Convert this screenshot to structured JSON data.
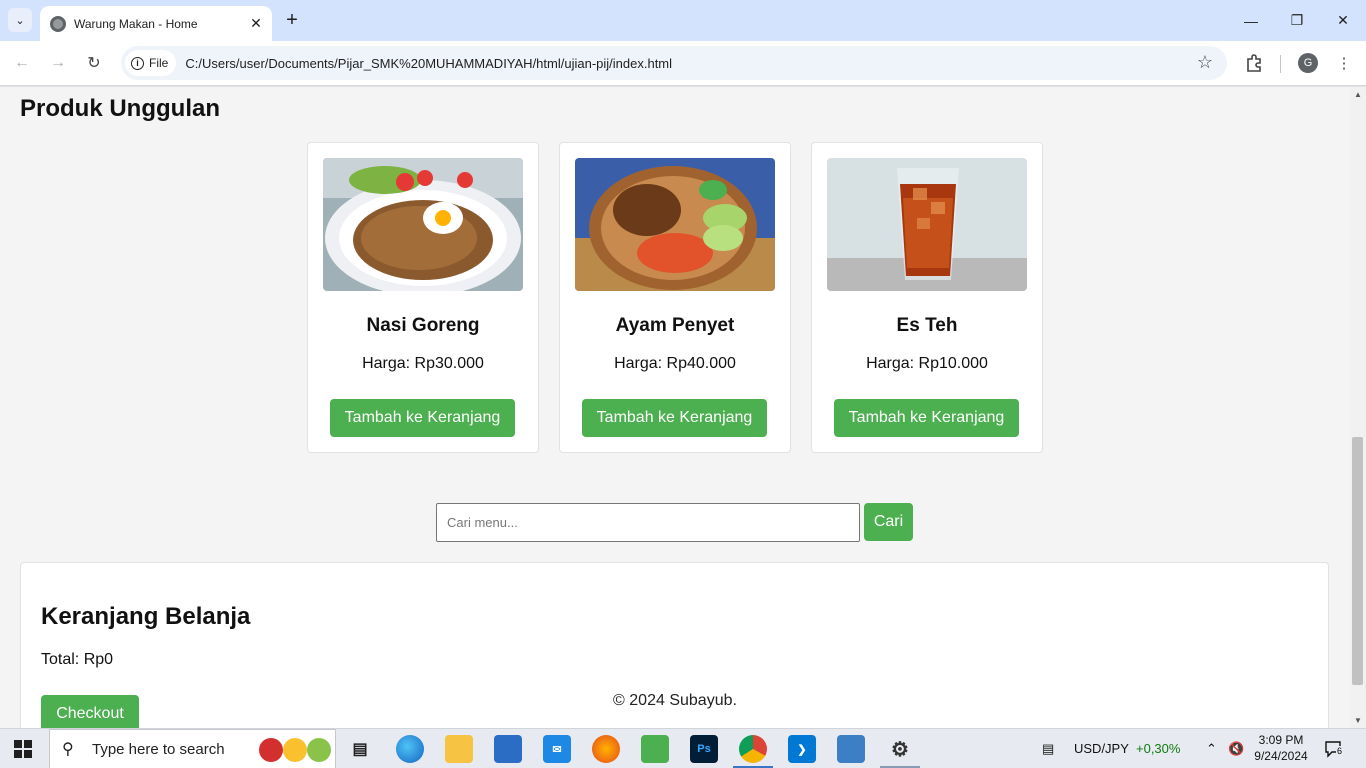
{
  "browser": {
    "tab_title": "Warung Makan - Home",
    "file_chip": "File",
    "url": "C:/Users/user/Documents/Pijar_SMK%20MUHAMMADIYAH/html/ujian-pij/index.html",
    "profile_initial": "G"
  },
  "page": {
    "section_title": "Produk Unggulan",
    "products": [
      {
        "name": "Nasi Goreng",
        "price": "Harga: Rp30.000",
        "button": "Tambah ke Keranjang",
        "image": "fried-rice-image"
      },
      {
        "name": "Ayam Penyet",
        "price": "Harga: Rp40.000",
        "button": "Tambah ke Keranjang",
        "image": "fried-chicken-image"
      },
      {
        "name": "Es Teh",
        "price": "Harga: Rp10.000",
        "button": "Tambah ke Keranjang",
        "image": "iced-tea-image"
      }
    ],
    "search": {
      "placeholder": "Cari menu...",
      "button": "Cari"
    },
    "cart": {
      "title": "Keranjang Belanja",
      "total": "Total: Rp0",
      "checkout": "Checkout"
    },
    "footer": "© 2024 Subayub."
  },
  "taskbar": {
    "search_placeholder": "Type here to search",
    "currency": "USD/JPY",
    "currency_change": "+0,30%",
    "time": "3:09 PM",
    "date": "9/24/2024",
    "notification_count": "6"
  },
  "colors": {
    "accent_green": "#4caf50",
    "chrome_blue": "#d3e3fd"
  }
}
